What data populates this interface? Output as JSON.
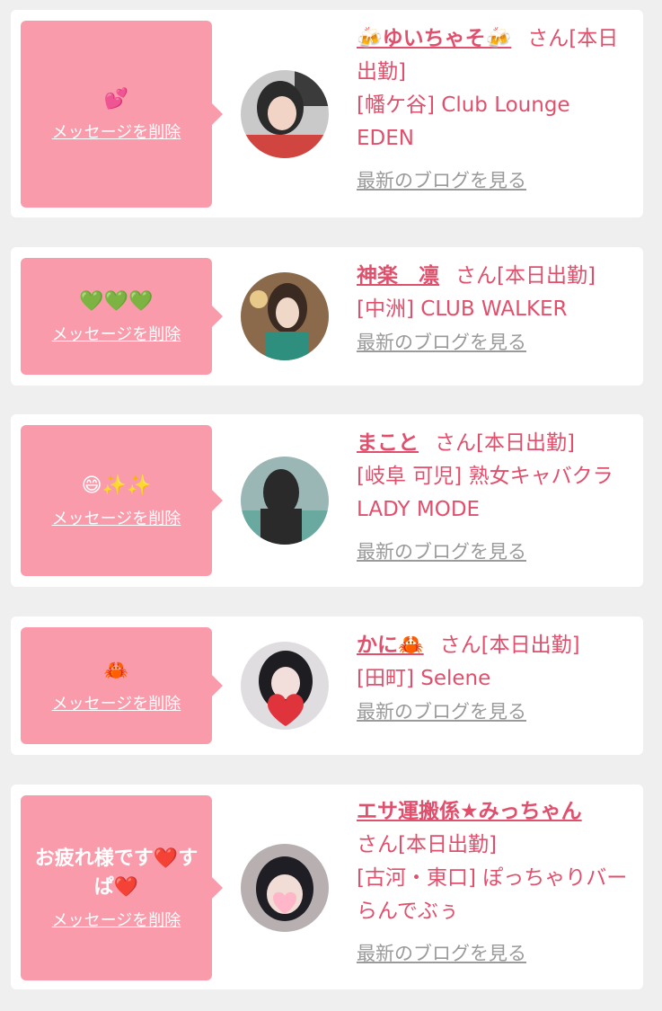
{
  "labels": {
    "delete_message": "メッセージを削除",
    "view_blog": "最新のブログを見る"
  },
  "messages": [
    {
      "bubble_text": "💕",
      "name": "🍻ゆいちゃそ🍻",
      "suffix": "さん[本日出勤]",
      "shop": "[幡ケ谷] Club Lounge EDEN",
      "avatar_colors": [
        "#c9c9c9",
        "#d0453f",
        "#2b2b2b"
      ]
    },
    {
      "bubble_text": "💚💚💚",
      "name": "神楽　凛",
      "suffix": "さん[本日出勤]",
      "shop": "[中洲] CLUB WALKER",
      "avatar_colors": [
        "#8a6a4a",
        "#2f8f7f",
        "#3a2a22"
      ]
    },
    {
      "bubble_text": "😄✨✨",
      "name": "まこと",
      "suffix": "さん[本日出勤]",
      "shop": "[岐阜 可児] 熟女キャバクラ LADY MODE",
      "avatar_colors": [
        "#6aa9a0",
        "#2a2a2a",
        "#9ab7b5"
      ]
    },
    {
      "bubble_text": "🦀",
      "name": "かに🦀",
      "suffix": "さん[本日出勤]",
      "shop": "[田町] Selene",
      "avatar_colors": [
        "#e0dde0",
        "#1d1d22",
        "#e0343c"
      ]
    },
    {
      "bubble_text": "お疲れ様です❤️すぱ❤️",
      "name": "エサ運搬係★みっちゃん",
      "suffix": "さん[本日出勤]",
      "shop": "[古河・東口] ぽっちゃりバー らんでぶぅ",
      "avatar_colors": [
        "#b8b0b0",
        "#1e1e24",
        "#ffb6c8"
      ]
    }
  ]
}
